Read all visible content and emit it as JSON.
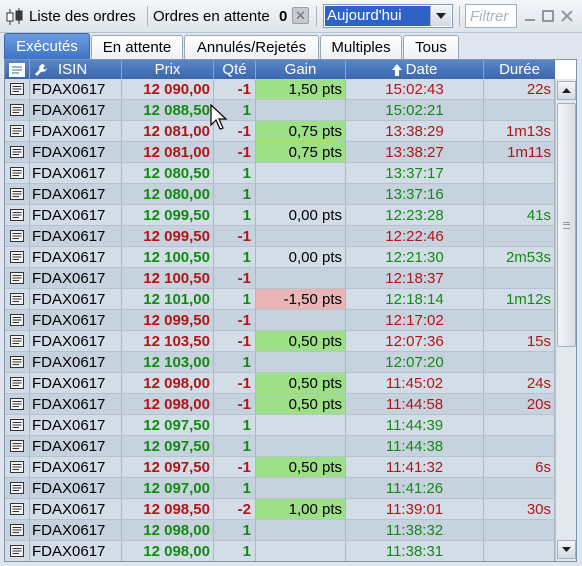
{
  "window": {
    "title": "Liste des ordres",
    "pending_label": "Ordres en attente",
    "pending_count": "0",
    "period_value": "Aujourd'hui",
    "filter_placeholder": "Filtrer"
  },
  "tabs": [
    {
      "label": "Exécutés",
      "active": true
    },
    {
      "label": "En attente",
      "active": false
    },
    {
      "label": "Annulés/Rejetés",
      "active": false
    },
    {
      "label": "Multiples",
      "active": false
    },
    {
      "label": "Tous",
      "active": false
    }
  ],
  "columns": {
    "isin": "ISIN",
    "prix": "Prix",
    "qte": "Qté",
    "gain": "Gain",
    "date": "Date",
    "duree": "Durée"
  },
  "colors": {
    "buy": "#138a13",
    "sell": "#b01616",
    "gain_positive": "#9de088",
    "gain_negative": "#e9b5b5",
    "header": "#3b67ad"
  },
  "rows": [
    {
      "isin": "FDAX0617",
      "prix": "12 090,00",
      "qte": "-1",
      "gain": "1,50 pts",
      "date": "15:02:43",
      "duree": "22s",
      "side": "sell",
      "gain_sign": "pos"
    },
    {
      "isin": "FDAX0617",
      "prix": "12 088,50",
      "qte": "1",
      "gain": "",
      "date": "15:02:21",
      "duree": "",
      "side": "buy",
      "gain_sign": ""
    },
    {
      "isin": "FDAX0617",
      "prix": "12 081,00",
      "qte": "-1",
      "gain": "0,75 pts",
      "date": "13:38:29",
      "duree": "1m13s",
      "side": "sell",
      "gain_sign": "pos"
    },
    {
      "isin": "FDAX0617",
      "prix": "12 081,00",
      "qte": "-1",
      "gain": "0,75 pts",
      "date": "13:38:27",
      "duree": "1m11s",
      "side": "sell",
      "gain_sign": "pos"
    },
    {
      "isin": "FDAX0617",
      "prix": "12 080,50",
      "qte": "1",
      "gain": "",
      "date": "13:37:17",
      "duree": "",
      "side": "buy",
      "gain_sign": ""
    },
    {
      "isin": "FDAX0617",
      "prix": "12 080,00",
      "qte": "1",
      "gain": "",
      "date": "13:37:16",
      "duree": "",
      "side": "buy",
      "gain_sign": ""
    },
    {
      "isin": "FDAX0617",
      "prix": "12 099,50",
      "qte": "1",
      "gain": "0,00 pts",
      "date": "12:23:28",
      "duree": "41s",
      "side": "buy",
      "gain_sign": ""
    },
    {
      "isin": "FDAX0617",
      "prix": "12 099,50",
      "qte": "-1",
      "gain": "",
      "date": "12:22:46",
      "duree": "",
      "side": "sell",
      "gain_sign": ""
    },
    {
      "isin": "FDAX0617",
      "prix": "12 100,50",
      "qte": "1",
      "gain": "0,00 pts",
      "date": "12:21:30",
      "duree": "2m53s",
      "side": "buy",
      "gain_sign": ""
    },
    {
      "isin": "FDAX0617",
      "prix": "12 100,50",
      "qte": "-1",
      "gain": "",
      "date": "12:18:37",
      "duree": "",
      "side": "sell",
      "gain_sign": ""
    },
    {
      "isin": "FDAX0617",
      "prix": "12 101,00",
      "qte": "1",
      "gain": "-1,50 pts",
      "date": "12:18:14",
      "duree": "1m12s",
      "side": "buy",
      "gain_sign": "neg"
    },
    {
      "isin": "FDAX0617",
      "prix": "12 099,50",
      "qte": "-1",
      "gain": "",
      "date": "12:17:02",
      "duree": "",
      "side": "sell",
      "gain_sign": ""
    },
    {
      "isin": "FDAX0617",
      "prix": "12 103,50",
      "qte": "-1",
      "gain": "0,50 pts",
      "date": "12:07:36",
      "duree": "15s",
      "side": "sell",
      "gain_sign": "pos"
    },
    {
      "isin": "FDAX0617",
      "prix": "12 103,00",
      "qte": "1",
      "gain": "",
      "date": "12:07:20",
      "duree": "",
      "side": "buy",
      "gain_sign": ""
    },
    {
      "isin": "FDAX0617",
      "prix": "12 098,00",
      "qte": "-1",
      "gain": "0,50 pts",
      "date": "11:45:02",
      "duree": "24s",
      "side": "sell",
      "gain_sign": "pos"
    },
    {
      "isin": "FDAX0617",
      "prix": "12 098,00",
      "qte": "-1",
      "gain": "0,50 pts",
      "date": "11:44:58",
      "duree": "20s",
      "side": "sell",
      "gain_sign": "pos"
    },
    {
      "isin": "FDAX0617",
      "prix": "12 097,50",
      "qte": "1",
      "gain": "",
      "date": "11:44:39",
      "duree": "",
      "side": "buy",
      "gain_sign": ""
    },
    {
      "isin": "FDAX0617",
      "prix": "12 097,50",
      "qte": "1",
      "gain": "",
      "date": "11:44:38",
      "duree": "",
      "side": "buy",
      "gain_sign": ""
    },
    {
      "isin": "FDAX0617",
      "prix": "12 097,50",
      "qte": "-1",
      "gain": "0,50 pts",
      "date": "11:41:32",
      "duree": "6s",
      "side": "sell",
      "gain_sign": "pos"
    },
    {
      "isin": "FDAX0617",
      "prix": "12 097,00",
      "qte": "1",
      "gain": "",
      "date": "11:41:26",
      "duree": "",
      "side": "buy",
      "gain_sign": ""
    },
    {
      "isin": "FDAX0617",
      "prix": "12 098,50",
      "qte": "-2",
      "gain": "1,00 pts",
      "date": "11:39:01",
      "duree": "30s",
      "side": "sell",
      "gain_sign": "pos"
    },
    {
      "isin": "FDAX0617",
      "prix": "12 098,00",
      "qte": "1",
      "gain": "",
      "date": "11:38:32",
      "duree": "",
      "side": "buy",
      "gain_sign": ""
    },
    {
      "isin": "FDAX0617",
      "prix": "12 098,00",
      "qte": "1",
      "gain": "",
      "date": "11:38:31",
      "duree": "",
      "side": "buy",
      "gain_sign": ""
    }
  ]
}
